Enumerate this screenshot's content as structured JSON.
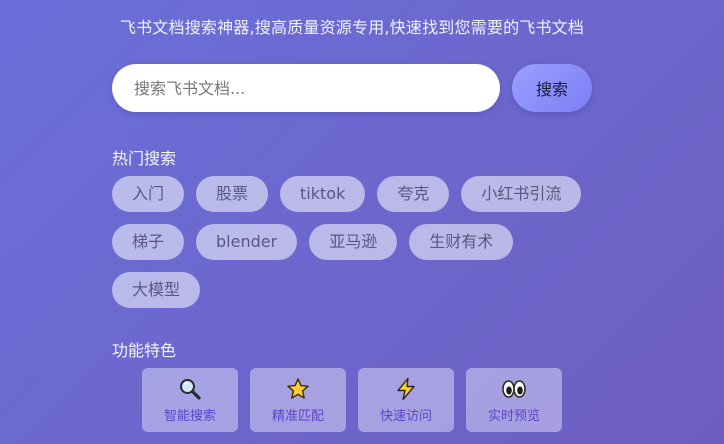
{
  "header": {
    "subtitle": "飞书文档搜索神器,搜高质量资源专用,快速找到您需要的飞书文档"
  },
  "search": {
    "placeholder": "搜索飞书文档...",
    "value": "",
    "button_label": "搜索"
  },
  "hot": {
    "title": "热门搜索",
    "tags": [
      "入门",
      "股票",
      "tiktok",
      "夸克",
      "小红书引流",
      "梯子",
      "blender",
      "亚马逊",
      "生财有术",
      "大模型"
    ]
  },
  "features": {
    "title": "功能特色",
    "items": [
      {
        "label": "智能搜索",
        "icon": "magnifier-icon"
      },
      {
        "label": "精准匹配",
        "icon": "star-icon"
      },
      {
        "label": "快速访问",
        "icon": "lightning-icon"
      },
      {
        "label": "实时预览",
        "icon": "eyes-icon"
      }
    ]
  },
  "colors": {
    "background_start": "#6a6fd9",
    "background_end": "#6f5ec0",
    "button": "#8c8ffa",
    "feature_label": "#5b46c9"
  }
}
